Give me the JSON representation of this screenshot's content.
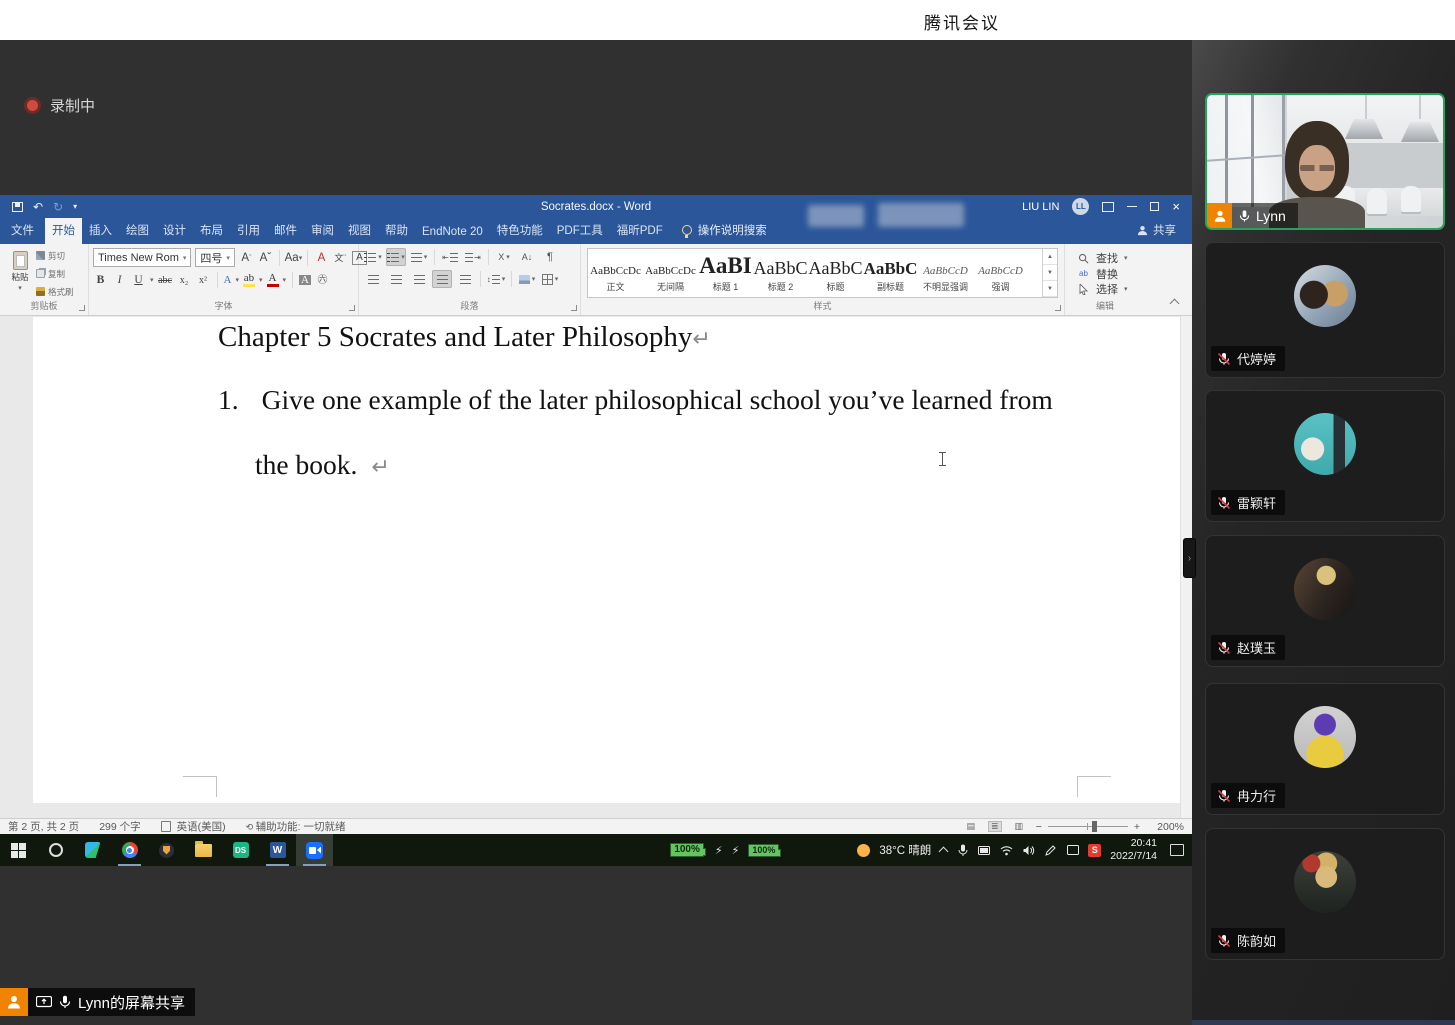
{
  "meeting": {
    "app_title": "腾讯会议",
    "recording_label": "录制中",
    "share_banner": "Lynn的屏幕共享",
    "accent_green": "#23a560",
    "accent_orange": "#f08300",
    "participants": [
      {
        "name": "Lynn",
        "muted": false,
        "sharing": true,
        "video": true
      },
      {
        "name": "代婷婷",
        "muted": true
      },
      {
        "name": "雷颖轩",
        "muted": true
      },
      {
        "name": "赵璞玉",
        "muted": true
      },
      {
        "name": "冉力行",
        "muted": true
      },
      {
        "name": "陈韵如",
        "muted": true
      }
    ]
  },
  "word": {
    "doc_title": "Socrates.docx - Word",
    "user": "LIU LIN",
    "user_initials": "LL",
    "share_button": "共享",
    "search_hint": "操作说明搜索",
    "tabs": [
      "文件",
      "开始",
      "插入",
      "绘图",
      "设计",
      "布局",
      "引用",
      "邮件",
      "审阅",
      "视图",
      "帮助",
      "EndNote 20",
      "特色功能",
      "PDF工具",
      "福昕PDF"
    ],
    "active_tab": "开始",
    "clipboard": {
      "paste": "粘贴",
      "cut": "剪切",
      "copy": "复制",
      "painter": "格式刷",
      "label": "剪贴板"
    },
    "font": {
      "name": "Times New Rom",
      "size": "四号",
      "label": "字体"
    },
    "paragraph": {
      "label": "段落"
    },
    "styles": {
      "label": "样式",
      "items": [
        {
          "preview": "AaBbCcDc",
          "name": "正文"
        },
        {
          "preview": "AaBbCcDc",
          "name": "无间隔"
        },
        {
          "preview": "AaBI",
          "name": "标题 1"
        },
        {
          "preview": "AaBbC",
          "name": "标题 2"
        },
        {
          "preview": "AaBbC",
          "name": "标题"
        },
        {
          "preview": "AaBbC",
          "name": "副标题"
        },
        {
          "preview": "AaBbCcD",
          "name": "不明显强调"
        },
        {
          "preview": "AaBbCcD",
          "name": "强调"
        }
      ]
    },
    "editing": {
      "find": "查找",
      "replace": "替换",
      "select": "选择",
      "label": "编辑"
    },
    "document": {
      "heading": "Chapter 5 Socrates and Later Philosophy",
      "list_number": "1.",
      "list_text": "Give one example of the later philosophical school you’ve learned from",
      "list_text_2": "the book.",
      "pilcrow": "↵"
    },
    "status": {
      "page": "第 2 页, 共 2 页",
      "words": "299 个字",
      "language": "英语(美国)",
      "accessibility": "辅助功能: 一切就绪",
      "zoom": "200%"
    }
  },
  "taskbar": {
    "battery_1": "100%",
    "battery_2": "100%",
    "weather": "38°C 晴朗",
    "time": "20:41",
    "date": "2022/7/14",
    "apps": [
      "start",
      "cortana",
      "thunder",
      "chrome",
      "security",
      "explorer",
      "deepseek",
      "word",
      "tencent-meeting"
    ]
  },
  "icons": {
    "record-dot": "red circle",
    "mic": "microphone",
    "mic-muted": "microphone with red slash",
    "screen-share": "monitor with arrow",
    "person": "person silhouette",
    "lightbulb": "bulb outline",
    "search": "magnifier"
  }
}
